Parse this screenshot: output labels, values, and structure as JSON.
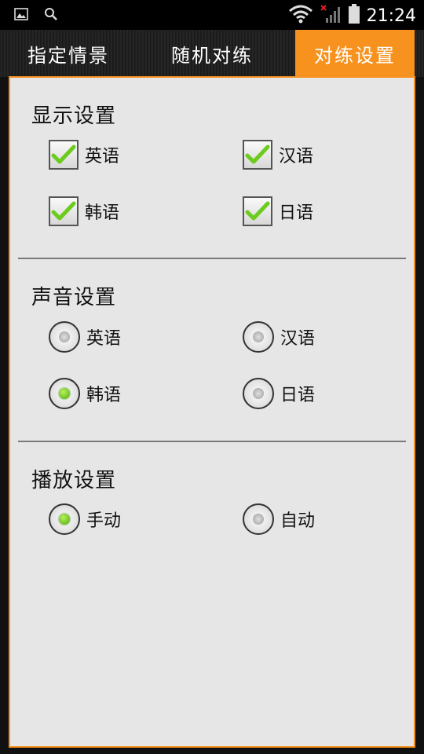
{
  "status": {
    "time": "21:24",
    "icons": [
      "gallery-icon",
      "search-icon",
      "wifi-icon",
      "signal-icon",
      "battery-icon"
    ]
  },
  "tabs": [
    {
      "label": "指定情景",
      "selected": false
    },
    {
      "label": "随机对练",
      "selected": false
    },
    {
      "label": "对练设置",
      "selected": true
    }
  ],
  "display": {
    "title": "显示设置",
    "options": [
      {
        "label": "英语",
        "checked": true
      },
      {
        "label": "汉语",
        "checked": true
      },
      {
        "label": "韩语",
        "checked": true
      },
      {
        "label": "日语",
        "checked": true
      }
    ]
  },
  "sound": {
    "title": "声音设置",
    "options": [
      {
        "label": "英语",
        "selected": false
      },
      {
        "label": "汉语",
        "selected": false
      },
      {
        "label": "韩语",
        "selected": true
      },
      {
        "label": "日语",
        "selected": false
      }
    ]
  },
  "playback": {
    "title": "播放设置",
    "options": [
      {
        "label": "手动",
        "selected": true
      },
      {
        "label": "自动",
        "selected": false
      }
    ]
  },
  "colors": {
    "accent": "#f7921e",
    "check": "#6ccb1f",
    "panel": "#e6e6e6"
  }
}
